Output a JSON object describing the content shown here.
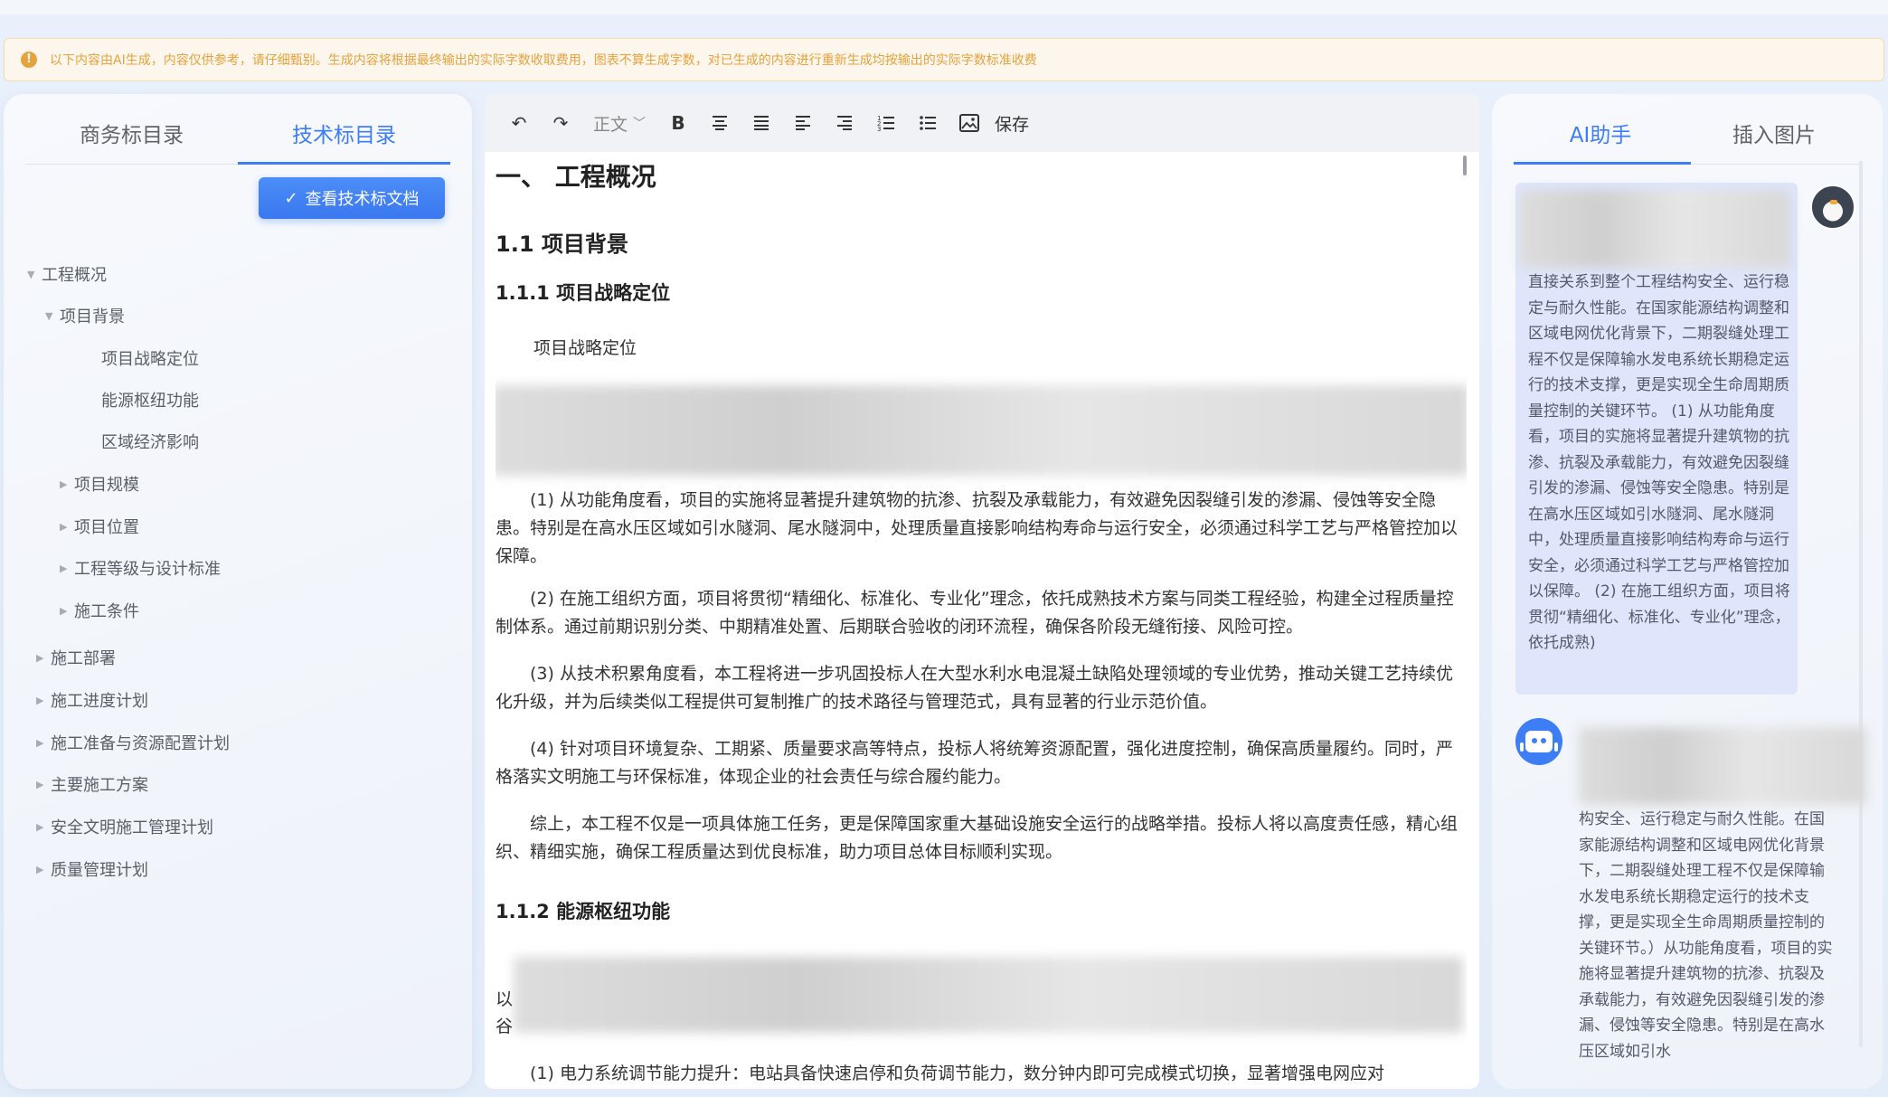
{
  "notice": {
    "text": "以下内容由AI生成，内容仅供参考，请仔细甄别。生成内容将根据最终输出的实际字数收取费用，图表不算生成字数，对已生成的内容进行重新生成均按输出的实际字数标准收费"
  },
  "left_panel": {
    "tabs": [
      {
        "label": "商务标目录",
        "active": false
      },
      {
        "label": "技术标目录",
        "active": true
      }
    ],
    "view_button": "查看技术标文档",
    "tree": [
      {
        "label": "工程概况",
        "level": 0,
        "expanded": true
      },
      {
        "label": "项目背景",
        "level": 1,
        "expanded": true
      },
      {
        "label": "项目战略定位",
        "level": 2
      },
      {
        "label": "能源枢纽功能",
        "level": 2
      },
      {
        "label": "区域经济影响",
        "level": 2
      },
      {
        "label": "项目规模",
        "level": 1,
        "expanded": false
      },
      {
        "label": "项目位置",
        "level": 1,
        "expanded": false
      },
      {
        "label": "工程等级与设计标准",
        "level": 1,
        "expanded": false
      },
      {
        "label": "施工条件",
        "level": 1,
        "expanded": false
      },
      {
        "label": "施工部署",
        "level": 0,
        "expanded": false
      },
      {
        "label": "施工进度计划",
        "level": 0,
        "expanded": false
      },
      {
        "label": "施工准备与资源配置计划",
        "level": 0,
        "expanded": false
      },
      {
        "label": "主要施工方案",
        "level": 0,
        "expanded": false
      },
      {
        "label": "安全文明施工管理计划",
        "level": 0,
        "expanded": false
      },
      {
        "label": "质量管理计划",
        "level": 0,
        "expanded": false
      }
    ]
  },
  "editor": {
    "toolbar": {
      "undo": "↶",
      "redo": "↷",
      "style_select": "正文",
      "bold": "B",
      "save": "保存"
    },
    "h1": "一、 工程概况",
    "h2": "1.1 项目背景",
    "h3_1": "1.1.1 项目战略定位",
    "sub_title": "项目战略定位",
    "paragraphs": [
      "(1) 从功能角度看，项目的实施将显著提升建筑物的抗渗、抗裂及承载能力，有效避免因裂缝引发的渗漏、侵蚀等安全隐患。特别是在高水压区域如引水隧洞、尾水隧洞中，处理质量直接影响结构寿命与运行安全，必须通过科学工艺与严格管控加以保障。",
      "(2) 在施工组织方面，项目将贯彻“精细化、标准化、专业化”理念，依托成熟技术方案与同类工程经验，构建全过程质量控制体系。通过前期识别分类、中期精准处置、后期联合验收的闭环流程，确保各阶段无缝衔接、风险可控。",
      "(3) 从技术积累角度看，本工程将进一步巩固投标人在大型水利水电混凝土缺陷处理领域的专业优势，推动关键工艺持续优化升级，并为后续类似工程提供可复制推广的技术路径与管理范式，具有显著的行业示范价值。",
      "(4) 针对项目环境复杂、工期紧、质量要求高等特点，投标人将统筹资源配置，强化进度控制，确保高质量履约。同时，严格落实文明施工与环保标准，体现企业的社会责任与综合履约能力。",
      "综上，本工程不仅是一项具体施工任务，更是保障国家重大基础设施安全运行的战略举措。投标人将以高度责任感，精心组织、精细实施，确保工程质量达到优良标准，助力项目总体目标顺利实现。"
    ],
    "h3_2": "1.1.2 能源枢纽功能",
    "partial_left_1": "以",
    "partial_left_2": "谷",
    "bottom_line": "(1) 电力系统调节能力提升：电站具备快速启停和负荷调节能力，数分钟内即可完成模式切换，显著增强电网应对"
  },
  "right_panel": {
    "tabs": [
      {
        "label": "AI助手",
        "active": true
      },
      {
        "label": "插入图片",
        "active": false
      }
    ],
    "user_message": "直接关系到整个工程结构安全、运行稳定与耐久性能。在国家能源结构调整和区域电网优化背景下，二期裂缝处理工程不仅是保障输水发电系统长期稳定运行的技术支撑，更是实现全生命周期质量控制的关键环节。 (1) 从功能角度看，项目的实施将显著提升建筑物的抗渗、抗裂及承载能力，有效避免因裂缝引发的渗漏、侵蚀等安全隐患。特别是在高水压区域如引水隧洞、尾水隧洞中，处理质量直接影响结构寿命与运行安全，必须通过科学工艺与严格管控加以保障。 (2) 在施工组织方面，项目将贯彻“精细化、标准化、专业化”理念，依托成熟)",
    "bot_message": "构安全、运行稳定与耐久性能。在国家能源结构调整和区域电网优化背景下，二期裂缝处理工程不仅是保障输水发电系统长期稳定运行的技术支撑，更是实现全生命周期质量控制的关键环节。）从功能角度看，项目的实施将显著提升建筑物的抗渗、抗裂及承载能力，有效避免因裂缝引发的渗漏、侵蚀等安全隐患。特别是在高水压区域如引水"
  }
}
